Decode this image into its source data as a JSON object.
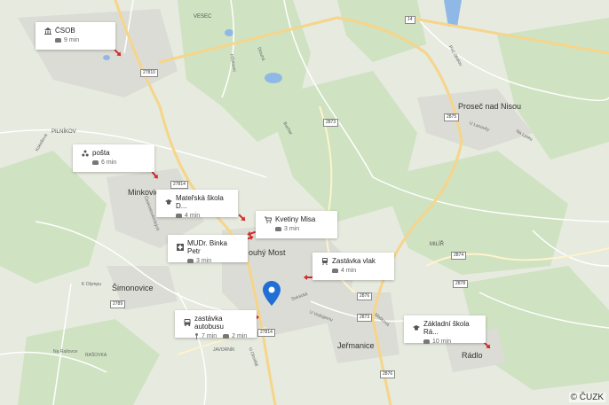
{
  "map": {
    "copyright": "© ČUZK",
    "colors": {
      "land": "#e6eadf",
      "forest": "#cfe2c2",
      "urban": "#dcdcd6",
      "water": "#8fb8e6",
      "road_main": "#f6d58a",
      "road_major": "#ffffff",
      "marker": "#1f6fd6",
      "arrow": "#d32a2a"
    },
    "places": {
      "minkovice": "Minkovice",
      "simonovice": "Šimonovice",
      "dlouhy_most": "ouhý Most",
      "jermanice": "Jeřmanice",
      "radlo": "Rádlo",
      "prosec": "Proseč nad Nisou",
      "vesec": "VESEC",
      "pilnikov": "PILNÍKOV",
      "milir": "MILÍŘ"
    },
    "streets": {
      "hrbitovni": "Hřbitovní",
      "u_ohnise": "U Ohniště",
      "dlouha": "Dlouhá",
      "bucharova": "Buchar",
      "k_olympu": "K Olympu",
      "ceskoslov": "Československých",
      "na_rasovce": "Na Rašovce",
      "rasovka": "RAŠOVKA",
      "javornik": "JAVORNÍK",
      "maskova": "Mašková",
      "solnicka": "Solnická",
      "u_vodojemu": "U Vodojemu",
      "u_lanovky": "U Lanovky",
      "pod_skaloum": "Pod Skalou",
      "na_lysku": "Na Lysku",
      "kokesova": "Kokešova"
    },
    "road_numbers": [
      "14",
      "27810",
      "27814",
      "27814",
      "2789",
      "2873",
      "2875",
      "2874",
      "2876",
      "2873",
      "2878",
      "2876"
    ]
  },
  "pois": [
    {
      "icon": "bank-icon",
      "name": "ČSOB",
      "time_car": "9 min"
    },
    {
      "icon": "post-icon",
      "name": "pošta",
      "time_car": "6 min"
    },
    {
      "icon": "school-icon",
      "name": "Mateřská škola D...",
      "time_car": "4 min"
    },
    {
      "icon": "shop-icon",
      "name": "Kvetiny Misa",
      "time_car": "3 min"
    },
    {
      "icon": "clinic-icon",
      "name": "MUDr. Binka Petr",
      "time_car": "3 min"
    },
    {
      "icon": "train-icon",
      "name": "Zastávka vlak",
      "time_car": "4 min"
    },
    {
      "icon": "bus-icon",
      "name": "zastávka autobusu",
      "time_walk": "7 min",
      "time_car": "2 min"
    },
    {
      "icon": "school-icon",
      "name": "Základní škola Rá...",
      "time_car": "10 min"
    }
  ]
}
